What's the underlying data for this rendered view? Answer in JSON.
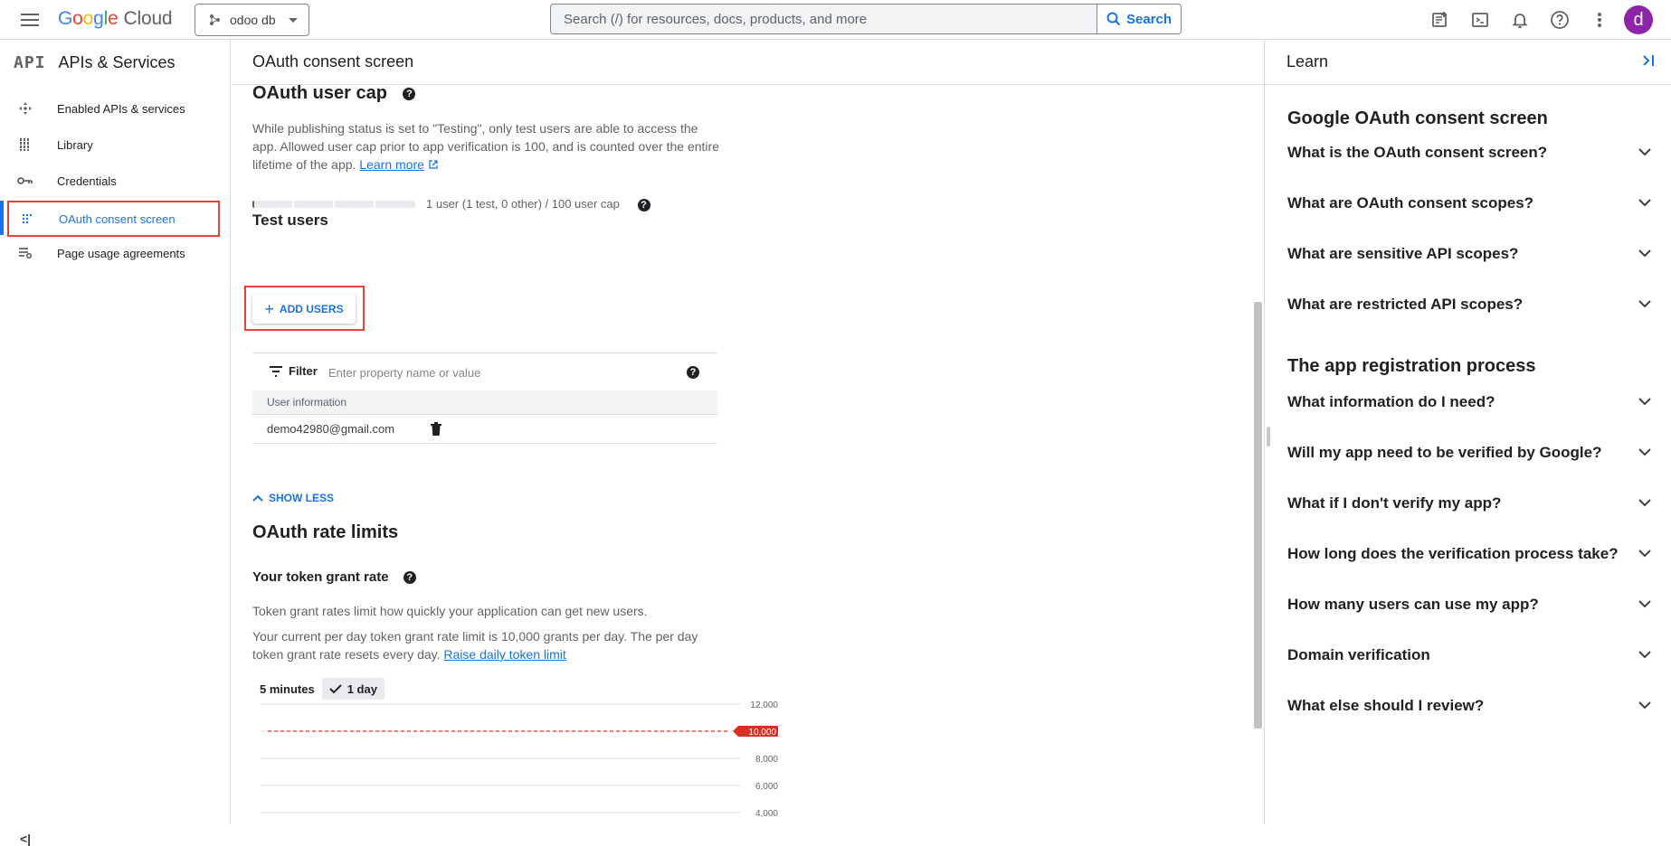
{
  "topbar": {
    "logo_google": "Google",
    "logo_cloud": "Cloud",
    "project": "odoo db",
    "search_placeholder": "Search (/) for resources, docs, products, and more",
    "search_button": "Search",
    "avatar_letter": "d"
  },
  "sidebar": {
    "logo": "API",
    "title": "APIs & Services",
    "items": [
      {
        "label": "Enabled APIs & services",
        "icon": "enabled-apis-icon"
      },
      {
        "label": "Library",
        "icon": "library-icon"
      },
      {
        "label": "Credentials",
        "icon": "key-icon"
      },
      {
        "label": "OAuth consent screen",
        "icon": "oauth-dots-icon",
        "active": true
      },
      {
        "label": "Page usage agreements",
        "icon": "settings-list-icon"
      }
    ],
    "collapse": "<|"
  },
  "main": {
    "title": "OAuth consent screen",
    "user_cap": {
      "heading": "OAuth user cap",
      "desc_before_link": "While publishing status is set to \"Testing\", only test users are able to access the app. Allowed user cap prior to app verification is 100, and is counted over the entire lifetime of the app.",
      "learn_more": "Learn more",
      "bar_fraction": 0.01,
      "bar_text": "1 user (1 test, 0 other) / 100 user cap"
    },
    "test_users": {
      "heading": "Test users",
      "add_button": "ADD USERS",
      "filter_label": "Filter",
      "filter_placeholder": "Enter property name or value",
      "column_header": "User information",
      "rows": [
        "demo42980@gmail.com"
      ]
    },
    "show_less": "SHOW LESS",
    "rate_limits": {
      "heading": "OAuth rate limits",
      "subheading": "Your token grant rate",
      "desc1": "Token grant rates limit how quickly your application can get new users.",
      "desc2_before_link": "Your current per day token grant rate limit is 10,000 grants per day. The per day token grant rate resets every day.",
      "raise_link": "Raise daily token limit",
      "toggle": [
        "5 minutes",
        "1 day"
      ],
      "toggle_selected": "1 day"
    }
  },
  "chart_data": {
    "type": "line",
    "title": "",
    "xlabel": "",
    "ylabel": "",
    "y_ticks": [
      12000,
      10000,
      8000,
      6000,
      4000
    ],
    "y_tick_labels": [
      "12,000",
      "10,000",
      "8,000",
      "6,000",
      "4,000"
    ],
    "ylim": [
      4000,
      12000
    ],
    "limit_line": {
      "value": 10000,
      "label": "10,000",
      "color": "#d93025"
    },
    "grid": true
  },
  "learn": {
    "title": "Learn",
    "sections": [
      {
        "heading": "Google OAuth consent screen",
        "items": [
          "What is the OAuth consent screen?",
          "What are OAuth consent scopes?",
          "What are sensitive API scopes?",
          "What are restricted API scopes?"
        ]
      },
      {
        "heading": "The app registration process",
        "items": [
          "What information do I need?",
          "Will my app need to be verified by Google?",
          "What if I don't verify my app?",
          "How long does the verification process take?",
          "How many users can use my app?",
          "Domain verification",
          "What else should I review?"
        ]
      }
    ]
  },
  "colors": {
    "accent": "#1a73e8",
    "highlight": "#ea4335",
    "avatar": "#8e24aa",
    "limit": "#d93025"
  }
}
